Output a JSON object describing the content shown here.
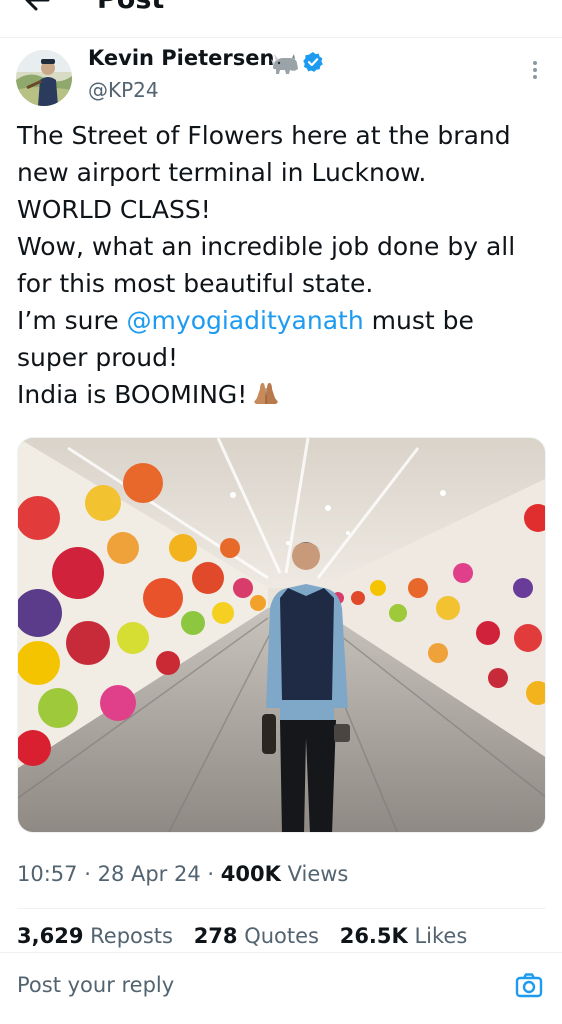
{
  "header": {
    "title": "Post",
    "back_icon": "arrow-left-icon"
  },
  "author": {
    "name": "Kevin Pietersen",
    "handle": "@KP24",
    "name_emoji": "rhino-emoji",
    "verified": true,
    "verified_color": "#1d9bf0"
  },
  "tweet": {
    "line1": "The Street of Flowers here at the brand",
    "line2": "new airport terminal in Lucknow.",
    "line3": "WORLD CLASS!",
    "line4": "Wow, what an incredible job done by all",
    "line5": "for this most beautiful state.",
    "line6_pre": "I’m sure ",
    "mention": "@myogiadityanath",
    "line6_post": " must be",
    "line7": "super proud!",
    "line8": "India is BOOMING!",
    "end_emoji": "folded-hands-emoji"
  },
  "media": {
    "type": "photo",
    "subject": "airport-corridor-glass-flowers"
  },
  "meta": {
    "time": "10:57",
    "sep": "·",
    "date": "28 Apr 24",
    "views_count": "400K",
    "views_label": "Views"
  },
  "stats": {
    "reposts_count": "3,629",
    "reposts_label": "Reposts",
    "quotes_count": "278",
    "quotes_label": "Quotes",
    "likes_count": "26.5K",
    "likes_label": "Likes"
  },
  "reply": {
    "placeholder": "Post your reply",
    "camera_icon": "camera-icon"
  },
  "colors": {
    "text": "#0f1419",
    "secondary": "#536471",
    "link": "#1d9bf0",
    "divider": "#eff3f4"
  }
}
